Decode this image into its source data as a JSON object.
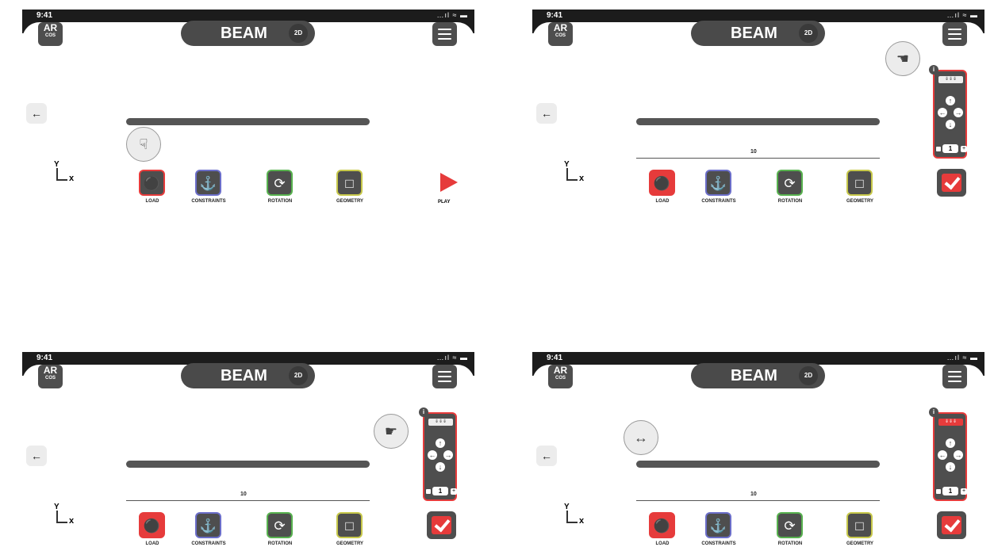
{
  "status_bar": {
    "time": "9:41",
    "icons": "…ıl ≈ ▬"
  },
  "app": {
    "logo_main": "AR",
    "logo_sub": "COS",
    "title": "BEAM",
    "mode_badge": "2D"
  },
  "beam": {
    "length_label": "10"
  },
  "axes": {
    "y": "Y",
    "x": "x"
  },
  "tools": {
    "load": {
      "label": "LOAD"
    },
    "constraints": {
      "label": "CONSTRAINTS"
    },
    "rotation": {
      "label": "ROTATION"
    },
    "geometry": {
      "label": "GEOMETRY"
    }
  },
  "play": {
    "label": "PLAY"
  },
  "panel": {
    "info": "i",
    "value": "1"
  },
  "screens": [
    {
      "name": "screen-1",
      "gesture": "tap-gesture-icon",
      "load_active": false,
      "show_panel": false
    },
    {
      "name": "screen-2",
      "gesture": "swipe-gesture-icon",
      "load_active": true,
      "show_panel": true,
      "slab_active": false
    },
    {
      "name": "screen-3",
      "gesture": "point-gesture-icon",
      "load_active": true,
      "show_panel": true,
      "slab_active": false
    },
    {
      "name": "screen-4",
      "gesture": "drag-gesture-icon",
      "load_active": true,
      "show_panel": true,
      "slab_active": true
    }
  ],
  "colors": {
    "accent": "#e63b3b",
    "dark": "#4e4e4e",
    "constraints": "#6b6ec9",
    "rotation": "#58b24f",
    "geometry": "#c7c84a"
  }
}
